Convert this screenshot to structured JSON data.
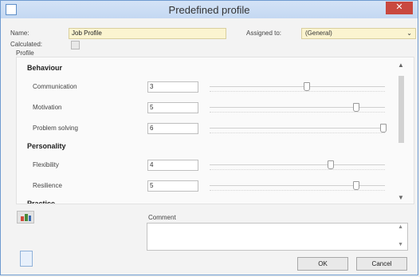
{
  "window": {
    "title": "Predefined profile",
    "close": "✕"
  },
  "form": {
    "name_label": "Name:",
    "name_value": "Job Profile",
    "assigned_label": "Assigned to:",
    "assigned_value": "(General)",
    "calculated_label": "Calculated:",
    "calculated_checked": false,
    "profile_label": "Profile"
  },
  "profile": {
    "sections": [
      {
        "title": "Behaviour",
        "criteria": [
          {
            "label": "Communication",
            "value": "3",
            "level": 0.55
          },
          {
            "label": "Motivation",
            "value": "5",
            "level": 0.84
          },
          {
            "label": "Problem solving",
            "value": "6",
            "level": 1.0
          }
        ]
      },
      {
        "title": "Personality",
        "criteria": [
          {
            "label": "Flexibility",
            "value": "4",
            "level": 0.69
          },
          {
            "label": "Resilience",
            "value": "5",
            "level": 0.84
          }
        ]
      },
      {
        "title": "Practice",
        "criteria": []
      }
    ]
  },
  "comment": {
    "label": "Comment",
    "value": ""
  },
  "buttons": {
    "ok": "OK",
    "cancel": "Cancel"
  },
  "icons": {
    "app": "window-icon",
    "chart": "chart-icon",
    "doc": "document-icon",
    "scroll_up": "▲",
    "scroll_down": "▼"
  }
}
